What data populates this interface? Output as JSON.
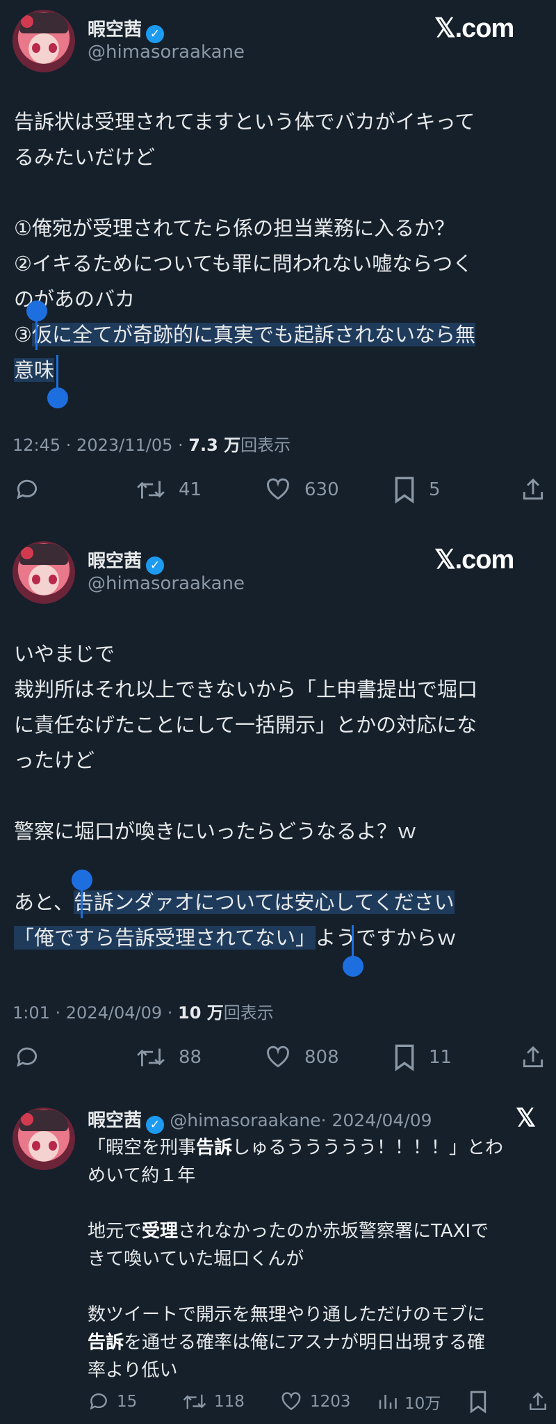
{
  "tweet1": {
    "name": "暇空茜",
    "handle": "@himasoraakane",
    "logo": "𝕏.com",
    "text_a": "告訴状は受理されてますという体でバカがイキって\nるみたいだけど\n\n①俺宛が受理されてたら係の担当業務に入るか？\n②イキるためについても罪に問われない嘘ならつく\nのがあのバカ\n③",
    "text_sel": "仮に全てが奇跡的に真実でも起訴されないなら無\n意味",
    "meta_time": "12:45 · 2023/11/05 · ",
    "meta_views": "7.3 万",
    "meta_views_label": "回表示",
    "retweets": "41",
    "likes": "630",
    "bookmarks": "5"
  },
  "tweet2": {
    "name": "暇空茜",
    "handle": "@himasoraakane",
    "logo": "𝕏.com",
    "text_a": "いやまじで\n裁判所はそれ以上できないから「上申書提出で堀口\nに責任なげたことにして一括開示」とかの対応にな\nったけど\n\n警察に堀口が喚きにいったらどうなるよ？ｗ\n\nあと、",
    "text_sel": "告訴ンダァオについては安心してください\n「俺ですら告訴受理されてない」",
    "text_b": "ようですからｗ",
    "meta_time": "1:01 · 2024/04/09 · ",
    "meta_views": "10 万",
    "meta_views_label": "回表示",
    "retweets": "88",
    "likes": "808",
    "bookmarks": "11"
  },
  "tweet3": {
    "name": "暇空茜",
    "handle": "@himasoraakane",
    "date": "· 2024/04/09",
    "logo": "𝕏",
    "p1_a": "「暇空を刑事",
    "p1_b": "告訴",
    "p1_c": "しゅるううううう！！！！」とわ\nめいて約１年",
    "p2_a": "地元で",
    "p2_b": "受理",
    "p2_c": "されなかったのか赤坂警察署にTAXIで\nきて喚いていた堀口くんが",
    "p3_a": "数ツイートで開示を無理やり通しただけのモブに\n",
    "p3_b": "告訴",
    "p3_c": "を通せる確率は俺にアスナが明日出現する確\n率より低い",
    "replies": "15",
    "retweets": "118",
    "likes": "1203",
    "views": "10万"
  },
  "colors": {
    "background": "#15202b",
    "text": "#e7e9ea",
    "secondary": "#8b98a5",
    "verified": "#1d9bf0",
    "selection": "#1f3b5c",
    "selection_handle": "#1d6fe0"
  }
}
